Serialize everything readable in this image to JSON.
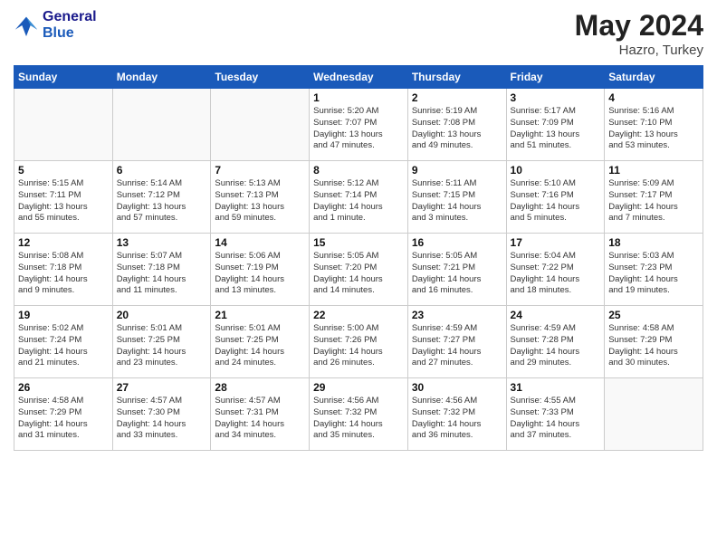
{
  "header": {
    "logo_line1": "General",
    "logo_line2": "Blue",
    "month_year": "May 2024",
    "location": "Hazro, Turkey"
  },
  "weekdays": [
    "Sunday",
    "Monday",
    "Tuesday",
    "Wednesday",
    "Thursday",
    "Friday",
    "Saturday"
  ],
  "weeks": [
    [
      {
        "day": "",
        "info": ""
      },
      {
        "day": "",
        "info": ""
      },
      {
        "day": "",
        "info": ""
      },
      {
        "day": "1",
        "info": "Sunrise: 5:20 AM\nSunset: 7:07 PM\nDaylight: 13 hours\nand 47 minutes."
      },
      {
        "day": "2",
        "info": "Sunrise: 5:19 AM\nSunset: 7:08 PM\nDaylight: 13 hours\nand 49 minutes."
      },
      {
        "day": "3",
        "info": "Sunrise: 5:17 AM\nSunset: 7:09 PM\nDaylight: 13 hours\nand 51 minutes."
      },
      {
        "day": "4",
        "info": "Sunrise: 5:16 AM\nSunset: 7:10 PM\nDaylight: 13 hours\nand 53 minutes."
      }
    ],
    [
      {
        "day": "5",
        "info": "Sunrise: 5:15 AM\nSunset: 7:11 PM\nDaylight: 13 hours\nand 55 minutes."
      },
      {
        "day": "6",
        "info": "Sunrise: 5:14 AM\nSunset: 7:12 PM\nDaylight: 13 hours\nand 57 minutes."
      },
      {
        "day": "7",
        "info": "Sunrise: 5:13 AM\nSunset: 7:13 PM\nDaylight: 13 hours\nand 59 minutes."
      },
      {
        "day": "8",
        "info": "Sunrise: 5:12 AM\nSunset: 7:14 PM\nDaylight: 14 hours\nand 1 minute."
      },
      {
        "day": "9",
        "info": "Sunrise: 5:11 AM\nSunset: 7:15 PM\nDaylight: 14 hours\nand 3 minutes."
      },
      {
        "day": "10",
        "info": "Sunrise: 5:10 AM\nSunset: 7:16 PM\nDaylight: 14 hours\nand 5 minutes."
      },
      {
        "day": "11",
        "info": "Sunrise: 5:09 AM\nSunset: 7:17 PM\nDaylight: 14 hours\nand 7 minutes."
      }
    ],
    [
      {
        "day": "12",
        "info": "Sunrise: 5:08 AM\nSunset: 7:18 PM\nDaylight: 14 hours\nand 9 minutes."
      },
      {
        "day": "13",
        "info": "Sunrise: 5:07 AM\nSunset: 7:18 PM\nDaylight: 14 hours\nand 11 minutes."
      },
      {
        "day": "14",
        "info": "Sunrise: 5:06 AM\nSunset: 7:19 PM\nDaylight: 14 hours\nand 13 minutes."
      },
      {
        "day": "15",
        "info": "Sunrise: 5:05 AM\nSunset: 7:20 PM\nDaylight: 14 hours\nand 14 minutes."
      },
      {
        "day": "16",
        "info": "Sunrise: 5:05 AM\nSunset: 7:21 PM\nDaylight: 14 hours\nand 16 minutes."
      },
      {
        "day": "17",
        "info": "Sunrise: 5:04 AM\nSunset: 7:22 PM\nDaylight: 14 hours\nand 18 minutes."
      },
      {
        "day": "18",
        "info": "Sunrise: 5:03 AM\nSunset: 7:23 PM\nDaylight: 14 hours\nand 19 minutes."
      }
    ],
    [
      {
        "day": "19",
        "info": "Sunrise: 5:02 AM\nSunset: 7:24 PM\nDaylight: 14 hours\nand 21 minutes."
      },
      {
        "day": "20",
        "info": "Sunrise: 5:01 AM\nSunset: 7:25 PM\nDaylight: 14 hours\nand 23 minutes."
      },
      {
        "day": "21",
        "info": "Sunrise: 5:01 AM\nSunset: 7:25 PM\nDaylight: 14 hours\nand 24 minutes."
      },
      {
        "day": "22",
        "info": "Sunrise: 5:00 AM\nSunset: 7:26 PM\nDaylight: 14 hours\nand 26 minutes."
      },
      {
        "day": "23",
        "info": "Sunrise: 4:59 AM\nSunset: 7:27 PM\nDaylight: 14 hours\nand 27 minutes."
      },
      {
        "day": "24",
        "info": "Sunrise: 4:59 AM\nSunset: 7:28 PM\nDaylight: 14 hours\nand 29 minutes."
      },
      {
        "day": "25",
        "info": "Sunrise: 4:58 AM\nSunset: 7:29 PM\nDaylight: 14 hours\nand 30 minutes."
      }
    ],
    [
      {
        "day": "26",
        "info": "Sunrise: 4:58 AM\nSunset: 7:29 PM\nDaylight: 14 hours\nand 31 minutes."
      },
      {
        "day": "27",
        "info": "Sunrise: 4:57 AM\nSunset: 7:30 PM\nDaylight: 14 hours\nand 33 minutes."
      },
      {
        "day": "28",
        "info": "Sunrise: 4:57 AM\nSunset: 7:31 PM\nDaylight: 14 hours\nand 34 minutes."
      },
      {
        "day": "29",
        "info": "Sunrise: 4:56 AM\nSunset: 7:32 PM\nDaylight: 14 hours\nand 35 minutes."
      },
      {
        "day": "30",
        "info": "Sunrise: 4:56 AM\nSunset: 7:32 PM\nDaylight: 14 hours\nand 36 minutes."
      },
      {
        "day": "31",
        "info": "Sunrise: 4:55 AM\nSunset: 7:33 PM\nDaylight: 14 hours\nand 37 minutes."
      },
      {
        "day": "",
        "info": ""
      }
    ]
  ]
}
